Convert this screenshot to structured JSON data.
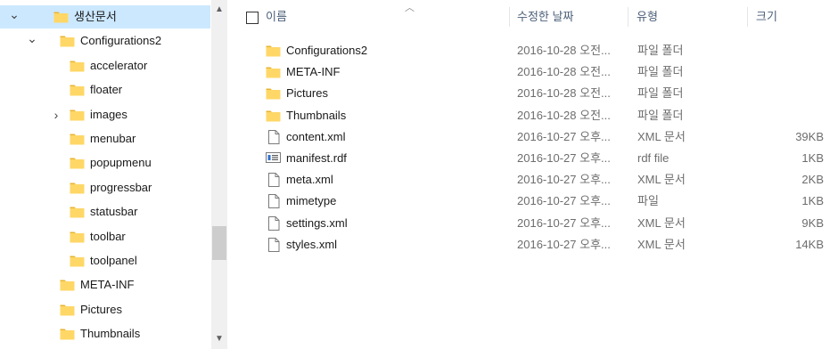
{
  "nav": {
    "items": [
      {
        "label": "생산문서",
        "arrow": "expanded",
        "selected": true
      },
      {
        "label": "Configurations2",
        "arrow": "expanded",
        "selected": false
      },
      {
        "label": "accelerator",
        "arrow": "",
        "selected": false
      },
      {
        "label": "floater",
        "arrow": "",
        "selected": false
      },
      {
        "label": "images",
        "arrow": "collapsed",
        "selected": false
      },
      {
        "label": "menubar",
        "arrow": "",
        "selected": false
      },
      {
        "label": "popupmenu",
        "arrow": "",
        "selected": false
      },
      {
        "label": "progressbar",
        "arrow": "",
        "selected": false
      },
      {
        "label": "statusbar",
        "arrow": "",
        "selected": false
      },
      {
        "label": "toolbar",
        "arrow": "",
        "selected": false
      },
      {
        "label": "toolpanel",
        "arrow": "",
        "selected": false
      },
      {
        "label": "META-INF",
        "arrow": "",
        "selected": false
      },
      {
        "label": "Pictures",
        "arrow": "",
        "selected": false
      },
      {
        "label": "Thumbnails",
        "arrow": "",
        "selected": false
      }
    ]
  },
  "columns": {
    "name": "이름",
    "date": "수정한 날짜",
    "type": "유형",
    "size": "크기"
  },
  "files": [
    {
      "name": "Configurations2",
      "date": "2016-10-28 오전...",
      "type": "파일 폴더",
      "size": "",
      "icon": "folder-icon"
    },
    {
      "name": "META-INF",
      "date": "2016-10-28 오전...",
      "type": "파일 폴더",
      "size": "",
      "icon": "folder-icon"
    },
    {
      "name": "Pictures",
      "date": "2016-10-28 오전...",
      "type": "파일 폴더",
      "size": "",
      "icon": "folder-icon"
    },
    {
      "name": "Thumbnails",
      "date": "2016-10-28 오전...",
      "type": "파일 폴더",
      "size": "",
      "icon": "folder-icon"
    },
    {
      "name": "content.xml",
      "date": "2016-10-27 오후...",
      "type": "XML 문서",
      "size": "39KB",
      "icon": "document-icon"
    },
    {
      "name": "manifest.rdf",
      "date": "2016-10-27 오후...",
      "type": "rdf file",
      "size": "1KB",
      "icon": "rdf-file-icon"
    },
    {
      "name": "meta.xml",
      "date": "2016-10-27 오후...",
      "type": "XML 문서",
      "size": "2KB",
      "icon": "document-icon"
    },
    {
      "name": "mimetype",
      "date": "2016-10-27 오후...",
      "type": "파일",
      "size": "1KB",
      "icon": "document-icon"
    },
    {
      "name": "settings.xml",
      "date": "2016-10-27 오후...",
      "type": "XML 문서",
      "size": "9KB",
      "icon": "document-icon"
    },
    {
      "name": "styles.xml",
      "date": "2016-10-27 오후...",
      "type": "XML 문서",
      "size": "14KB",
      "icon": "document-icon"
    }
  ],
  "colors": {
    "selected_bg": "#cce8ff",
    "folder_yellow": "#ffd766",
    "folder_dark": "#e8b531",
    "header_text": "#4c607a"
  }
}
